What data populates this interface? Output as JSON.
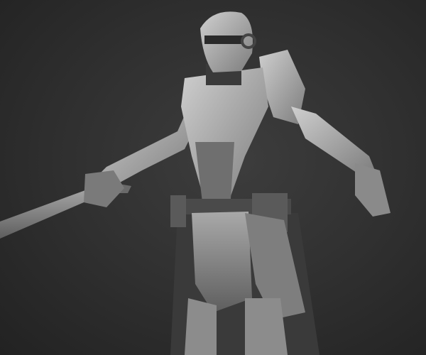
{
  "colors": {
    "background": "#2f2f2f",
    "armor_light": "#b8b8b8",
    "armor_mid": "#8a8a8a",
    "armor_dark": "#4a4a4a",
    "joint_dark": "#1e1e1e"
  },
  "subject": {
    "icon": "armored-knight-render"
  }
}
